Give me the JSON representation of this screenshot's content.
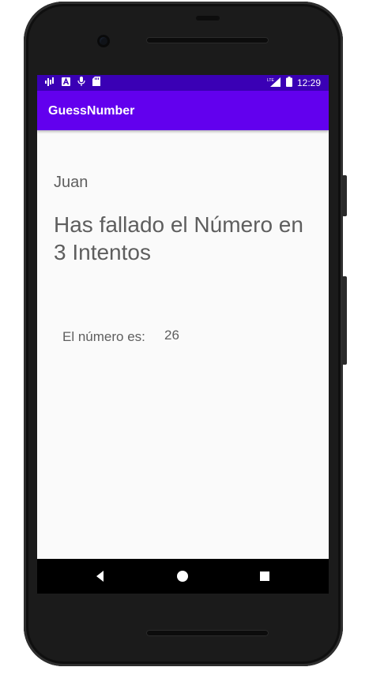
{
  "status_bar": {
    "time": "12:29",
    "left_icons": [
      "signal-activity-icon",
      "a-app-icon",
      "microphone-icon",
      "sd-card-icon"
    ],
    "network_label": "LTE"
  },
  "app_bar": {
    "title": "GuessNumber",
    "color": "#6200ee",
    "status_color": "#3a00b5"
  },
  "main": {
    "player_name": "Juan",
    "result_message": "Has fallado el Número en 3 Intentos",
    "number_label": "El número es:",
    "number_value": "26"
  },
  "nav_bar": {
    "buttons": [
      "back-icon",
      "home-icon",
      "recents-icon"
    ]
  }
}
